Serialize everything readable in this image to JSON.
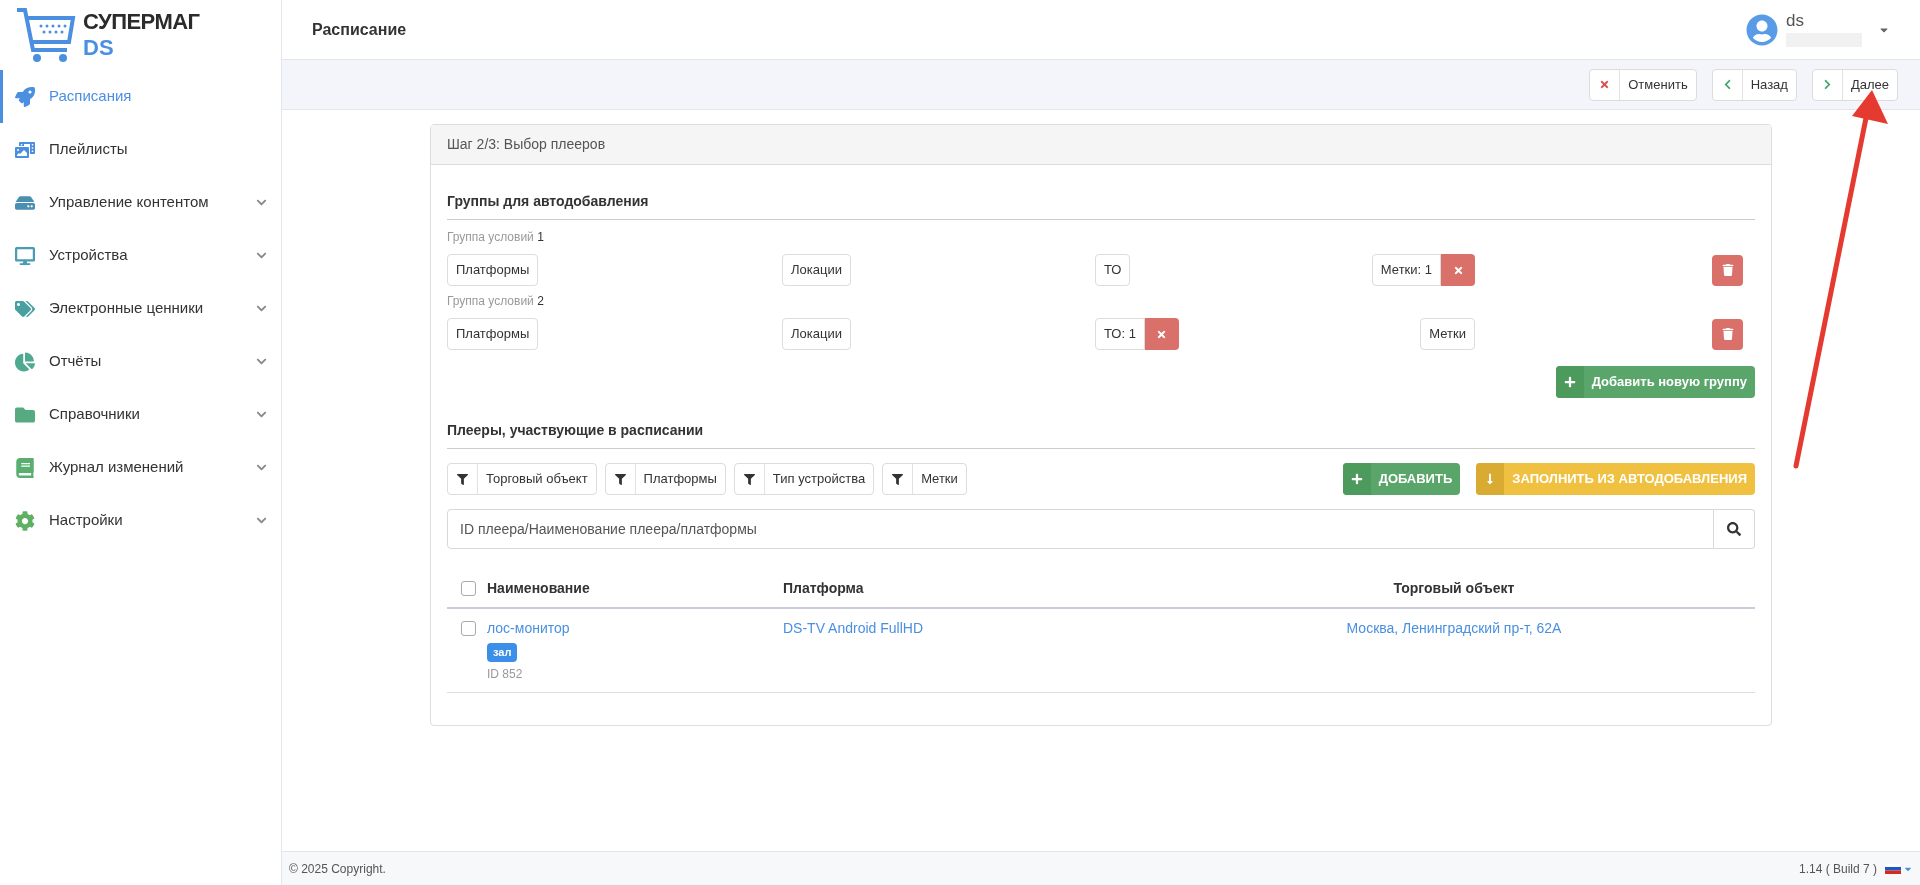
{
  "logo": {
    "title": "СУПЕРМАГ",
    "subtitle": "DS"
  },
  "sidebar": {
    "items": [
      {
        "label": "Расписания",
        "selected": true,
        "expandable": false
      },
      {
        "label": "Плейлисты",
        "selected": false,
        "expandable": false
      },
      {
        "label": "Управление контентом",
        "selected": false,
        "expandable": true
      },
      {
        "label": "Устройства",
        "selected": false,
        "expandable": true
      },
      {
        "label": "Электронные ценники",
        "selected": false,
        "expandable": true
      },
      {
        "label": "Отчёты",
        "selected": false,
        "expandable": true
      },
      {
        "label": "Справочники",
        "selected": false,
        "expandable": true
      },
      {
        "label": "Журнал изменений",
        "selected": false,
        "expandable": true
      },
      {
        "label": "Настройки",
        "selected": false,
        "expandable": true
      }
    ]
  },
  "header": {
    "title": "Расписание",
    "user": "ds"
  },
  "toolbar": {
    "buttons": [
      {
        "kind": "cancel",
        "label": "Отменить"
      },
      {
        "kind": "back",
        "label": "Назад"
      },
      {
        "kind": "next",
        "label": "Далее"
      }
    ]
  },
  "card": {
    "title": "Шаг 2/3: Выбор плееров",
    "auto_groups": {
      "title": "Группы для автодобавления",
      "groups": [
        {
          "label": "Группа условий",
          "number": "1",
          "filters": [
            {
              "label": "Платформы",
              "active": false
            },
            {
              "label": "Локации",
              "active": false
            },
            {
              "label": "ТО",
              "active": false
            },
            {
              "label": "Метки: 1",
              "active": true
            }
          ]
        },
        {
          "label": "Группа условий",
          "number": "2",
          "filters": [
            {
              "label": "Платформы",
              "active": false
            },
            {
              "label": "Локации",
              "active": false
            },
            {
              "label": "ТО: 1",
              "active": true
            },
            {
              "label": "Метки",
              "active": false
            }
          ]
        }
      ],
      "add_group_button": "Добавить новую группу"
    },
    "players": {
      "title": "Плееры, участвующие в расписании",
      "filters": [
        "Торговый объект",
        "Платформы",
        "Тип устройства",
        "Метки"
      ],
      "add_button": "ДОБАВИТЬ",
      "fill_button": "ЗАПОЛНИТЬ ИЗ АВТОДОБАВЛЕНИЯ",
      "search": {
        "placeholder": "ID плеера/Наименование плеера/платформы"
      },
      "table": {
        "select_all_checked": false,
        "columns": [
          "Наименование",
          "Платформа",
          "Торговый объект"
        ],
        "rows": [
          {
            "checked": false,
            "name": "лос-монитор",
            "tag": "зал",
            "id": "ID 852",
            "platform": "DS-TV Android FullHD",
            "store": "Москва, Ленинградский пр-т, 62А"
          }
        ]
      }
    }
  },
  "footer": {
    "copyright": "© 2025 Copyright.",
    "version": "1.14 ( Build 7 )"
  }
}
